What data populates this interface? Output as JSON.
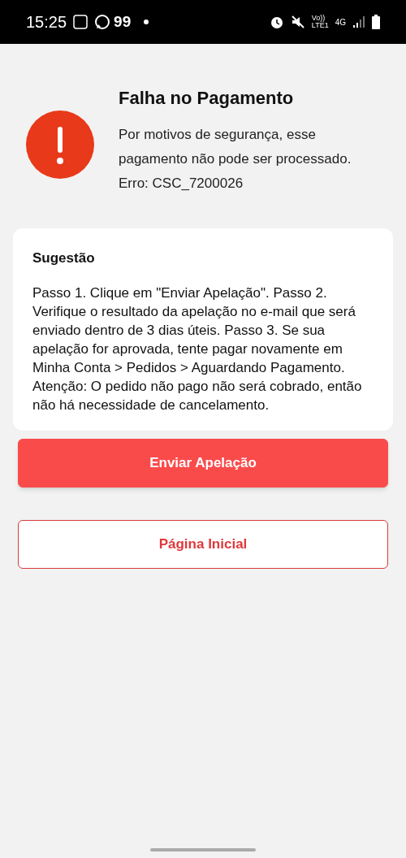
{
  "status_bar": {
    "time": "15:25",
    "notification_count": "99",
    "volte": "Vo))",
    "lte": "LTE1",
    "network": "4G"
  },
  "result": {
    "title": "Falha no Pagamento",
    "message": "Por motivos de segurança, esse pagamento não pode ser processado.",
    "error": "Erro: CSC_7200026"
  },
  "suggestion": {
    "title": "Sugestão",
    "text": "Passo 1. Clique em \"Enviar Apelação\". Passo 2. Verifique o resultado da apelação no e-mail que será enviado dentro de 3 dias úteis. Passo 3. Se sua apelação for aprovada, tente pagar novamente em Minha Conta > Pedidos > Aguardando Pagamento. Atenção: O pedido não pago não será cobrado, então não há necessidade de cancelamento."
  },
  "buttons": [
    {
      "label": "Enviar Apelação",
      "kind": "primary"
    },
    {
      "label": "Página Inicial",
      "kind": "outline"
    }
  ]
}
